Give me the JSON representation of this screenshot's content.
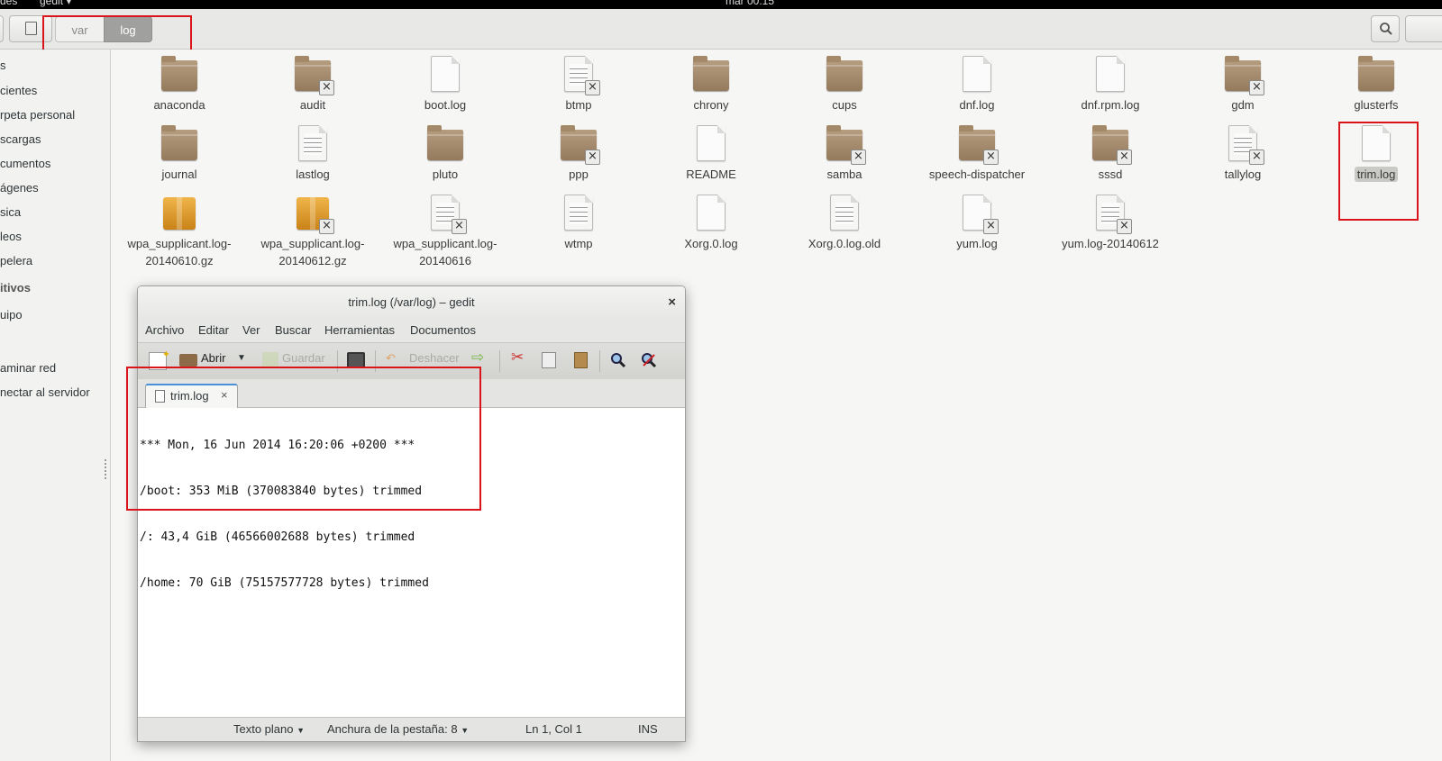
{
  "topbar": {
    "activities_fragment": "des",
    "app_menu": "gedit ▾",
    "clock": "mar 00:15"
  },
  "header": {
    "breadcrumb": [
      "var",
      "log"
    ],
    "icons": {
      "location": "bookmark-icon",
      "search": "search-icon"
    }
  },
  "sidebar": {
    "items": [
      "s",
      "cientes",
      "rpeta personal",
      "scargas",
      "cumentos",
      "ágenes",
      "sica",
      "leos",
      "pelera",
      "itivos",
      "uipo",
      "aminar red",
      "nectar al servidor"
    ]
  },
  "files": [
    {
      "name": "anaconda",
      "kind": "folder",
      "locked": false
    },
    {
      "name": "audit",
      "kind": "folder",
      "locked": true
    },
    {
      "name": "boot.log",
      "kind": "doc",
      "locked": false
    },
    {
      "name": "btmp",
      "kind": "text",
      "locked": true
    },
    {
      "name": "chrony",
      "kind": "folder",
      "locked": false
    },
    {
      "name": "cups",
      "kind": "folder",
      "locked": false
    },
    {
      "name": "dnf.log",
      "kind": "doc",
      "locked": false
    },
    {
      "name": "dnf.rpm.log",
      "kind": "doc",
      "locked": false
    },
    {
      "name": "gdm",
      "kind": "folder",
      "locked": true
    },
    {
      "name": "glusterfs",
      "kind": "folder",
      "locked": false
    },
    {
      "name": "journal",
      "kind": "folder",
      "locked": false
    },
    {
      "name": "lastlog",
      "kind": "text",
      "locked": false
    },
    {
      "name": "pluto",
      "kind": "folder",
      "locked": false
    },
    {
      "name": "ppp",
      "kind": "folder",
      "locked": true
    },
    {
      "name": "README",
      "kind": "doc",
      "locked": false
    },
    {
      "name": "samba",
      "kind": "folder",
      "locked": true
    },
    {
      "name": "speech-dispatcher",
      "kind": "folder",
      "locked": true
    },
    {
      "name": "sssd",
      "kind": "folder",
      "locked": true
    },
    {
      "name": "tallylog",
      "kind": "text",
      "locked": true
    },
    {
      "name": "trim.log",
      "kind": "doc",
      "locked": false,
      "selected": true
    },
    {
      "name": "wpa_supplicant.log-\n20140610.gz",
      "kind": "package",
      "locked": false
    },
    {
      "name": "wpa_supplicant.log-\n20140612.gz",
      "kind": "package",
      "locked": true
    },
    {
      "name": "wpa_supplicant.log-\n20140616",
      "kind": "text",
      "locked": true
    },
    {
      "name": "wtmp",
      "kind": "text",
      "locked": false
    },
    {
      "name": "Xorg.0.log",
      "kind": "doc",
      "locked": false
    },
    {
      "name": "Xorg.0.log.old",
      "kind": "text",
      "locked": false
    },
    {
      "name": "yum.log",
      "kind": "doc",
      "locked": true
    },
    {
      "name": "yum.log-20140612",
      "kind": "text",
      "locked": true
    }
  ],
  "gedit": {
    "title": "trim.log (/var/log) – gedit",
    "close": "×",
    "menu": [
      "Archivo",
      "Editar",
      "Ver",
      "Buscar",
      "Herramientas",
      "Documentos"
    ],
    "toolbar": {
      "open": "Abrir",
      "save": "Guardar",
      "undo": "Deshacer"
    },
    "tab": {
      "label": "trim.log",
      "close": "×"
    },
    "content": [
      "*** Mon, 16 Jun 2014 16:20:06 +0200 ***",
      "/boot: 353 MiB (370083840 bytes) trimmed",
      "/: 43,4 GiB (46566002688 bytes) trimmed",
      "/home: 70 GiB (75157577728 bytes) trimmed"
    ],
    "status": {
      "language": "Texto plano",
      "tab_width": "Anchura de la pestaña: 8",
      "position": "Ln 1, Col 1",
      "mode": "INS"
    }
  },
  "colors": {
    "highlight_box": "#d9141b",
    "folder": "#a38968",
    "tab_accent": "#4a90d9"
  }
}
